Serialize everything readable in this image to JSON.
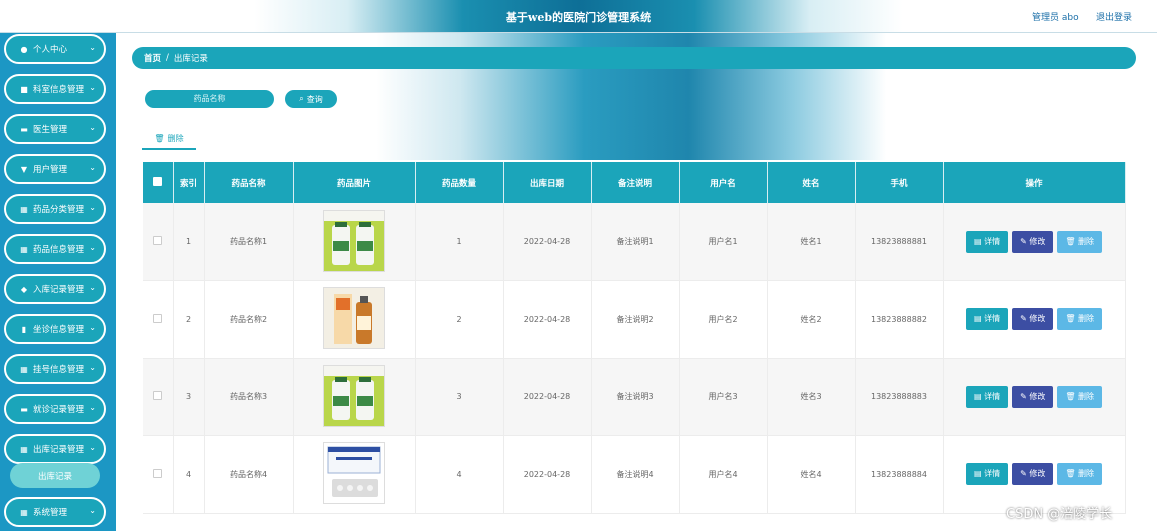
{
  "header": {
    "title": "基于web的医院门诊管理系统",
    "role": "管理员 abo",
    "logout": "退出登录"
  },
  "sidebar": {
    "items": [
      {
        "label": "个人中心",
        "icon": "user-icon"
      },
      {
        "label": "科室信息管理",
        "icon": "building-icon"
      },
      {
        "label": "医生管理",
        "icon": "briefcase-icon"
      },
      {
        "label": "用户管理",
        "icon": "pin-icon"
      },
      {
        "label": "药品分类管理",
        "icon": "grid-icon"
      },
      {
        "label": "药品信息管理",
        "icon": "grid-icon"
      },
      {
        "label": "入库记录管理",
        "icon": "thumb-icon"
      },
      {
        "label": "坐诊信息管理",
        "icon": "chart-icon"
      },
      {
        "label": "挂号信息管理",
        "icon": "grid-icon"
      },
      {
        "label": "就诊记录管理",
        "icon": "card-icon"
      },
      {
        "label": "出库记录管理",
        "icon": "grid-icon"
      },
      {
        "label": "系统管理",
        "icon": "grid-icon"
      }
    ],
    "submenu_active": "出库记录"
  },
  "breadcrumb": {
    "home": "首页",
    "sep": "/",
    "current": "出库记录"
  },
  "search": {
    "placeholder": "药品名称",
    "button": "查询"
  },
  "toolbar": {
    "delete_label": "删除"
  },
  "table": {
    "headers": [
      "索引",
      "药品名称",
      "药品图片",
      "药品数量",
      "出库日期",
      "备注说明",
      "用户名",
      "姓名",
      "手机",
      "操作"
    ],
    "rows": [
      {
        "index": "1",
        "name": "药品名称1",
        "image": "bottles-green",
        "qty": "1",
        "date": "2022-04-28",
        "note": "备注说明1",
        "user": "用户名1",
        "realname": "姓名1",
        "phone": "13823888881"
      },
      {
        "index": "2",
        "name": "药品名称2",
        "image": "syrup-box",
        "qty": "2",
        "date": "2022-04-28",
        "note": "备注说明2",
        "user": "用户名2",
        "realname": "姓名2",
        "phone": "13823888882"
      },
      {
        "index": "3",
        "name": "药品名称3",
        "image": "bottles-green",
        "qty": "3",
        "date": "2022-04-28",
        "note": "备注说明3",
        "user": "用户名3",
        "realname": "姓名3",
        "phone": "13823888883"
      },
      {
        "index": "4",
        "name": "药品名称4",
        "image": "tablet-box",
        "qty": "4",
        "date": "2022-04-28",
        "note": "备注说明4",
        "user": "用户名4",
        "realname": "姓名4",
        "phone": "13823888884"
      }
    ],
    "actions": {
      "detail": "详情",
      "edit": "修改",
      "delete": "删除"
    }
  },
  "watermark": "CSDN @涪陵学长"
}
